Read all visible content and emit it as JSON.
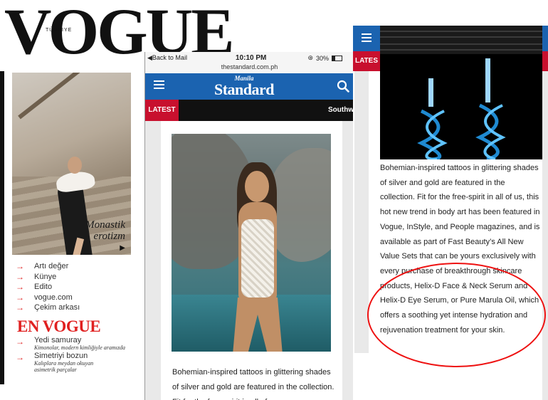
{
  "vogue": {
    "title": "VOGUE",
    "subtitle": "TÜRKIYE",
    "cover_caption_line1": "Monastik",
    "cover_caption_line2": "erotizm",
    "nav": [
      "Artı değer",
      "Künye",
      "Edito",
      "vogue.com",
      "Çekim arkası"
    ],
    "section_title": "EN VOGUE",
    "features": [
      {
        "title": "Yedi samuray",
        "desc": "Kimonolar, modern kimliğiyle aramızda"
      },
      {
        "title": "Simetriyi bozun",
        "desc_line1": "Kalıplara meydan okuyan",
        "desc_line2": "asimetrik parçalar"
      }
    ],
    "arrow_color": "#e02020"
  },
  "phone": {
    "back_label": "Back to Mail",
    "time": "10:10 PM",
    "battery": "30%",
    "url": "thestandard.com.ph",
    "logo_top": "Manila",
    "logo_main": "Standard",
    "latest_label": "LATEST",
    "ticker_text": "Southw",
    "article_text": "Bohemian-inspired tattoos in glittering shades of silver and gold are featured in the collection. Fit for the free-spirit in all of us,",
    "brand_color": "#1b63b0",
    "latest_color": "#c8102e"
  },
  "article": {
    "latest_label": "LATES",
    "body_text": "Bohemian-inspired tattoos in glittering shades of silver and gold are featured in the collection. Fit for the free-spirit in all of us, this hot new trend in body art has been featured in Vogue, InStyle, and People magazines, and is available as part of Fast Beauty’s All New Value Sets that can be yours exclusively with every purchase of breakthrough skincare products, Helix-D Face & Neck Serum and Helix-D Eye Serum, or Pure Marula Oil, which offers a soothing yet intense hydration and rejuvenation treatment for your skin.",
    "highlight_color": "#ee1111"
  }
}
